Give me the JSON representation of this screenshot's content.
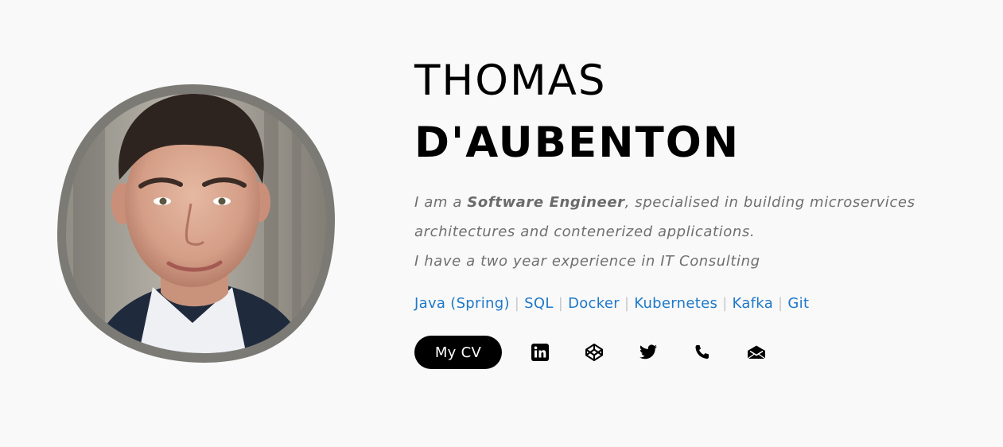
{
  "profile": {
    "first_name": "THOMAS",
    "last_name": "D'AUBENTON",
    "photo_alt": "Thomas d'Aubenton"
  },
  "intro": {
    "line1_prefix": "I am a ",
    "role": "Software Engineer",
    "line1_suffix": ", specialised in building microservices architectures and contenerized applications.",
    "line2": "I have a two year experience in IT Consulting"
  },
  "skills": [
    "Java (Spring)",
    "SQL",
    "Docker",
    "Kubernetes",
    "Kafka",
    "Git"
  ],
  "skills_separator": "|",
  "actions": {
    "cv_label": "My CV"
  },
  "social": [
    {
      "icon": "linkedin-icon"
    },
    {
      "icon": "codepen-icon"
    },
    {
      "icon": "twitter-icon"
    },
    {
      "icon": "phone-icon"
    },
    {
      "icon": "envelope-icon"
    }
  ],
  "colors": {
    "background": "#f9f9f9",
    "accent_link": "#1d78c9",
    "text_muted": "#6f6f6f",
    "button_bg": "#000000"
  }
}
